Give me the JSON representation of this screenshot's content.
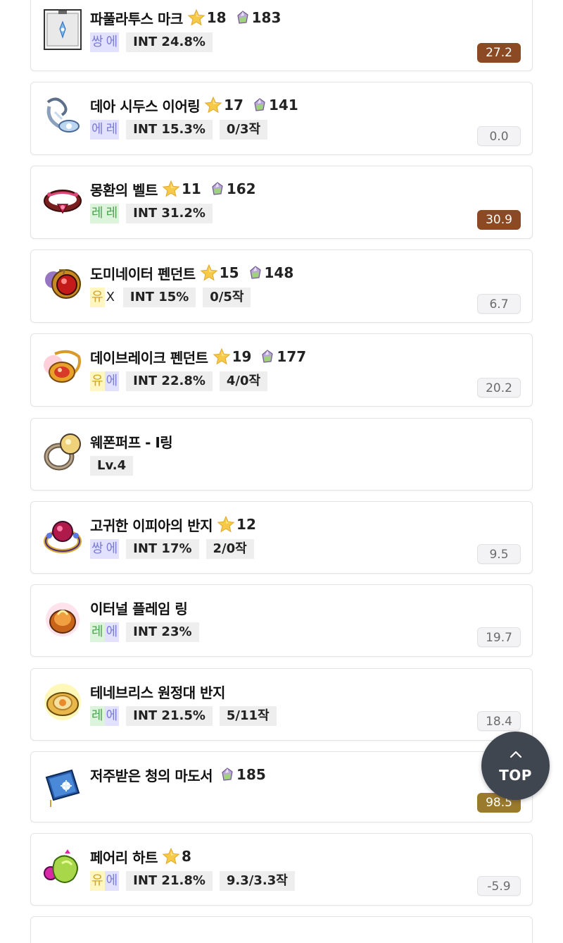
{
  "items": [
    {
      "name": "파풀라투스 마크",
      "star": "18",
      "gem": "183",
      "potential": [
        {
          "ch": "쌍",
          "cls": "p-ssang"
        },
        {
          "ch": "에",
          "cls": "p-e"
        }
      ],
      "tags": [
        "INT 24.8%"
      ],
      "score": "27.2",
      "score_style": "brown"
    },
    {
      "name": "데아 시두스 이어링",
      "star": "17",
      "gem": "141",
      "potential": [
        {
          "ch": "에",
          "cls": "p-e"
        },
        {
          "ch": "레",
          "cls": "p-e"
        }
      ],
      "tags": [
        "INT 15.3%",
        "0/3작"
      ],
      "score": "0.0",
      "score_style": "gray"
    },
    {
      "name": "몽환의 벨트",
      "star": "11",
      "gem": "162",
      "potential": [
        {
          "ch": "레",
          "cls": "p-re"
        },
        {
          "ch": "레",
          "cls": "p-re"
        }
      ],
      "tags": [
        "INT 31.2%"
      ],
      "score": "30.9",
      "score_style": "brown"
    },
    {
      "name": "도미네이터 펜던트",
      "star": "15",
      "gem": "148",
      "potential": [
        {
          "ch": "유",
          "cls": "p-yu"
        },
        {
          "ch": "X",
          "cls": "p-x"
        }
      ],
      "tags": [
        "INT 15%",
        "0/5작"
      ],
      "score": "6.7",
      "score_style": "gray"
    },
    {
      "name": "데이브레이크 펜던트",
      "star": "19",
      "gem": "177",
      "potential": [
        {
          "ch": "유",
          "cls": "p-yu"
        },
        {
          "ch": "에",
          "cls": "p-e"
        }
      ],
      "tags": [
        "INT 22.8%",
        "4/0작"
      ],
      "score": "20.2",
      "score_style": "gray"
    },
    {
      "name": "웨폰퍼프 - I링",
      "star": "",
      "gem": "",
      "potential": [],
      "tags": [
        "Lv.4"
      ],
      "score": "",
      "score_style": "none"
    },
    {
      "name": "고귀한 이피아의 반지",
      "star": "12",
      "gem": "",
      "potential": [
        {
          "ch": "쌍",
          "cls": "p-ssang"
        },
        {
          "ch": "에",
          "cls": "p-e"
        }
      ],
      "tags": [
        "INT 17%",
        "2/0작"
      ],
      "score": "9.5",
      "score_style": "gray"
    },
    {
      "name": "이터널 플레임 링",
      "star": "",
      "gem": "",
      "potential": [
        {
          "ch": "레",
          "cls": "p-re"
        },
        {
          "ch": "에",
          "cls": "p-e"
        }
      ],
      "tags": [
        "INT 23%"
      ],
      "score": "19.7",
      "score_style": "gray"
    },
    {
      "name": "테네브리스 원정대 반지",
      "star": "",
      "gem": "",
      "potential": [
        {
          "ch": "레",
          "cls": "p-re"
        },
        {
          "ch": "에",
          "cls": "p-e"
        }
      ],
      "tags": [
        "INT 21.5%",
        "5/11작"
      ],
      "score": "18.4",
      "score_style": "gray"
    },
    {
      "name": "저주받은 청의 마도서",
      "star": "",
      "gem": "185",
      "potential": [],
      "tags": [],
      "score": "98.5",
      "score_style": "gold"
    },
    {
      "name": "페어리 하트",
      "star": "8",
      "gem": "",
      "potential": [
        {
          "ch": "유",
          "cls": "p-yu"
        },
        {
          "ch": "에",
          "cls": "p-e"
        }
      ],
      "tags": [
        "INT 21.8%",
        "9.3/3.3작"
      ],
      "score": "-5.9",
      "score_style": "gray"
    },
    {
      "name": "",
      "star": "",
      "gem": "",
      "potential": [],
      "tags": [],
      "score": "",
      "score_style": "none"
    }
  ],
  "icons": [
    "paplatus-mark-icon",
    "dea-sidus-earring-icon",
    "dreamy-belt-icon",
    "dominator-pendant-icon",
    "daybreak-pendant-icon",
    "weapon-puff-ring-icon",
    "noble-ifia-ring-icon",
    "eternal-flame-ring-icon",
    "tenebris-ring-icon",
    "cursed-spellbook-icon",
    "fairy-heart-icon",
    "partial-item-icon"
  ],
  "top_button": {
    "label": "TOP"
  },
  "colors": {
    "score_brown": "#8b4a24",
    "score_gold": "#9a7a2c",
    "top_button_bg": "#3f464f"
  }
}
